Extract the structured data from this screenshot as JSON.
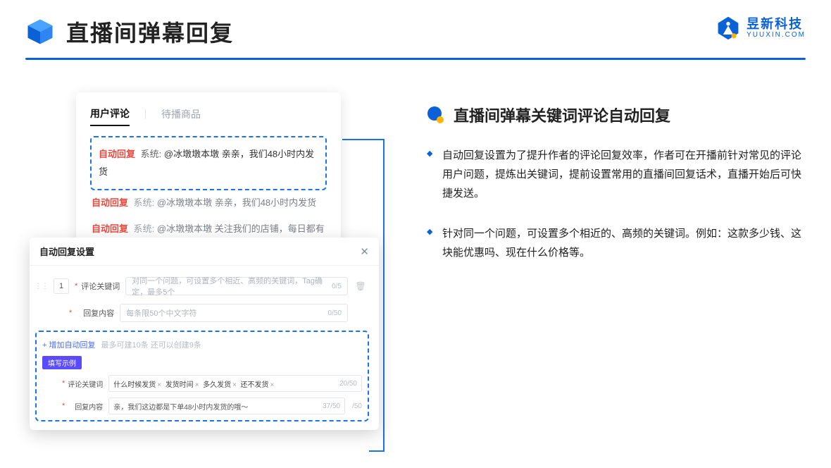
{
  "header": {
    "title": "直播间弹幕回复"
  },
  "brand": {
    "cn": "昱新科技",
    "en": "YUUXIN.COM"
  },
  "section": {
    "title": "直播间弹幕关键词评论自动回复",
    "bullets": [
      "自动回复设置为了提升作者的评论回复效率，作者可在开播前针对常见的评论用户问题，提炼出关键词，提前设置常用的直播间回复话术，直播开始后可快捷发送。",
      "针对同一个问题，可设置多个相近的、高频的关键词。例如：这款多少钱、这块能优惠吗、现在什么价格等。"
    ]
  },
  "comments_card": {
    "tabs": {
      "active": "用户评论",
      "inactive": "待播商品"
    },
    "badge_auto": "自动回复",
    "system_label": "系统:",
    "items": [
      {
        "highlight": true,
        "text": "@冰墩墩本墩 亲亲，我们48小时内发货"
      },
      {
        "highlight": false,
        "text": "@冰墩墩本墩 亲亲，我们48小时内发货"
      },
      {
        "highlight": false,
        "text": "@冰墩墩本墩 关注我们的店铺，每日都有热门推荐呦～"
      }
    ]
  },
  "modal": {
    "title": "自动回复设置",
    "index": "1",
    "labels": {
      "keyword": "评论关键词",
      "content": "回复内容"
    },
    "placeholders": {
      "keyword": "对同一个问题，可设置多个相近、高频的关键词，Tag确定，最多5个",
      "content": "每条限50个中文字符"
    },
    "counts": {
      "kw": "0/5",
      "ct": "0/50"
    },
    "add_label": "+ 增加自动回复",
    "add_hint": "最多可建10条 还可以创建9条",
    "example_title": "填写示例",
    "example": {
      "tags": [
        "什么时候发货",
        "发货时间",
        "多久发货",
        "还不发货"
      ],
      "kw_count": "20/50",
      "content": "亲，我们这边都是下单48小时内发货的哦～",
      "ct_count": "37/50",
      "side_count": "/50"
    }
  }
}
